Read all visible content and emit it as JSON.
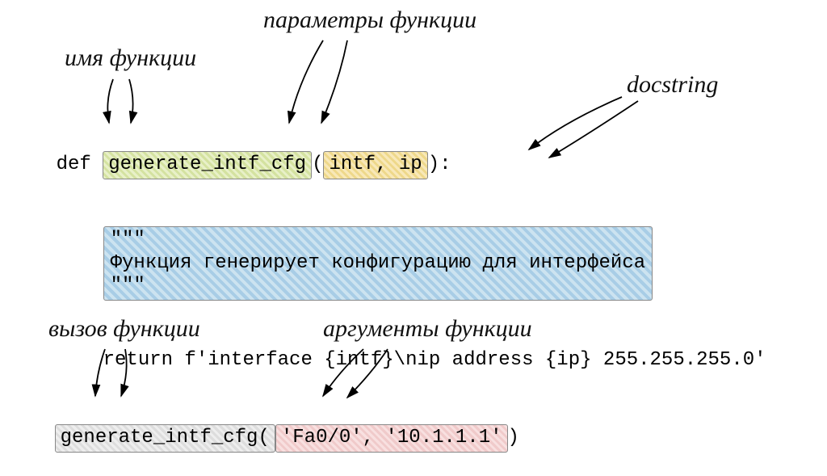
{
  "labels": {
    "function_name": "имя функции",
    "function_params": "параметры функции",
    "docstring": "docstring",
    "function_call": "вызов функции",
    "function_args": "аргументы функции"
  },
  "code": {
    "def_kw": "def ",
    "func_name": "generate_intf_cfg",
    "paren_open": "(",
    "params": "intf, ip",
    "paren_close_colon": "):",
    "doc_open": "\"\"\"",
    "doc_text": "Функция генерирует конфигурацию для интерфейса",
    "doc_close": "\"\"\"",
    "return_line": "return f'interface {intf}\\nip address {ip} 255.255.255.0'",
    "call_name": "generate_intf_cfg",
    "call_paren_open": "(",
    "call_args": "'Fa0/0', '10.1.1.1'",
    "call_paren_close": ")"
  }
}
